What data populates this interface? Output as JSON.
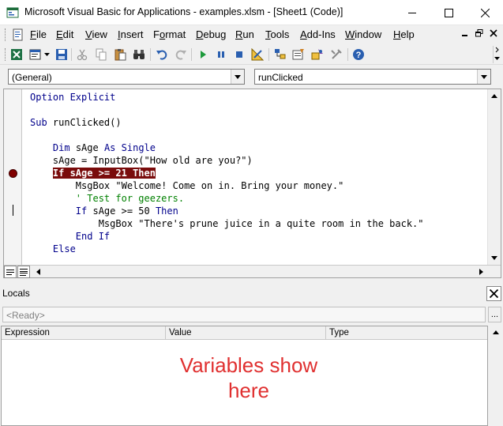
{
  "window": {
    "title": "Microsoft Visual Basic for Applications - examples.xlsm - [Sheet1 (Code)]",
    "minimize_glyph": "—",
    "maximize_glyph": "☐",
    "close_glyph": "✕"
  },
  "menu": {
    "items": [
      {
        "label": "File",
        "u": "F",
        "rest": "ile"
      },
      {
        "label": "Edit",
        "u": "E",
        "rest": "dit"
      },
      {
        "label": "View",
        "u": "V",
        "rest": "iew"
      },
      {
        "label": "Insert",
        "u": "I",
        "rest": "nsert"
      },
      {
        "label": "Format",
        "u": "F",
        "rest": "ormat",
        "pre": "",
        "uidx": 1
      },
      {
        "label": "Debug",
        "u": "D",
        "rest": "ebug"
      },
      {
        "label": "Run",
        "u": "R",
        "rest": "un"
      },
      {
        "label": "Tools",
        "u": "T",
        "rest": "ools"
      },
      {
        "label": "Add-Ins",
        "u": "A",
        "rest": "dd-Ins"
      },
      {
        "label": "Window",
        "u": "W",
        "rest": "indow"
      },
      {
        "label": "Help",
        "u": "H",
        "rest": "elp"
      }
    ],
    "mdi_minimize": "_",
    "mdi_restore": "❐",
    "mdi_close": "×"
  },
  "combos": {
    "object": "(General)",
    "procedure": "runClicked"
  },
  "code": {
    "lines": [
      "Option Explicit",
      "",
      "Sub runClicked()",
      "",
      "    Dim sAge As Single",
      "    sAge = InputBox(\"How old are you?\")",
      "    If sAge >= 21 Then",
      "        MsgBox \"Welcome! Come on in. Bring your money.\"",
      "        ' Test for geezers.",
      "        If sAge >= 50 Then",
      "            MsgBox \"There's prune juice in a quite room in the back.\"",
      "        End If",
      "    Else"
    ]
  },
  "locals": {
    "title": "Locals",
    "status": "<Ready>",
    "columns": [
      "Expression",
      "Value",
      "Type"
    ],
    "close_glyph": "✕",
    "ellipsis": "..."
  },
  "annotation": {
    "line1": "Variables show",
    "line2": "here"
  },
  "colors": {
    "keyword": "#00008b",
    "comment": "#008000",
    "breakpoint": "#800000",
    "breakpoint_highlight": "#7a0c0c",
    "annotation": "#e03030"
  }
}
